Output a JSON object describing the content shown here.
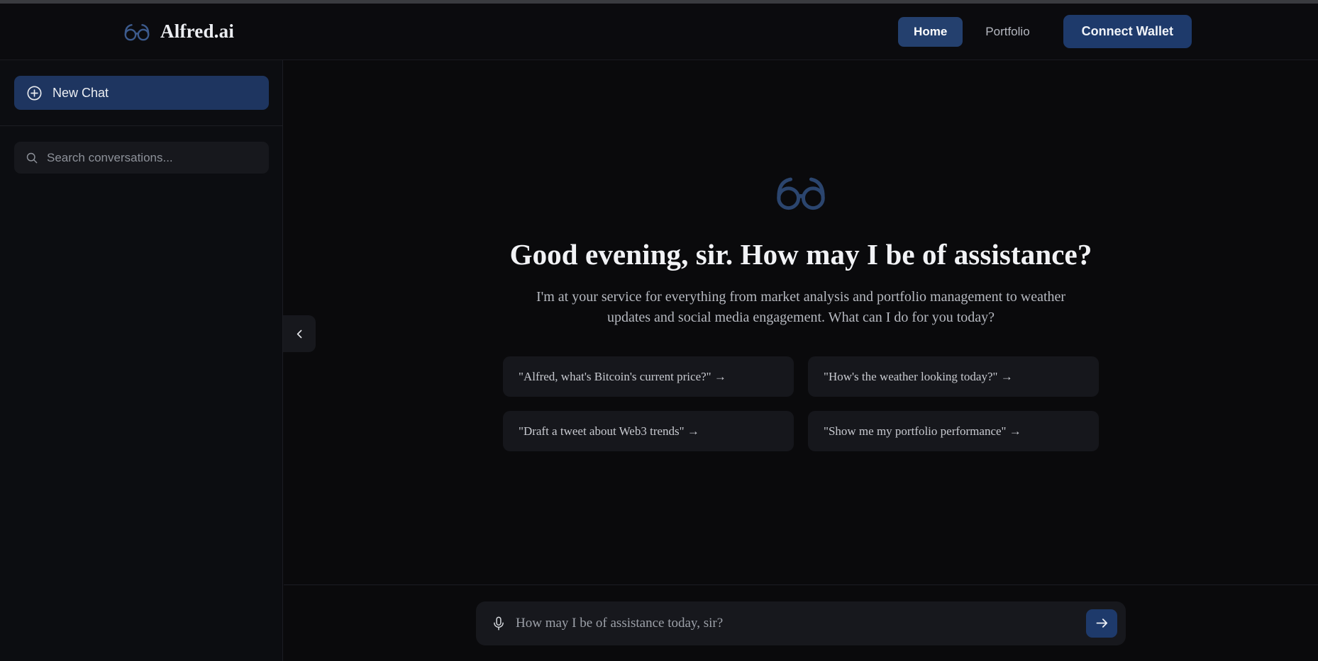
{
  "colors": {
    "page_bg": "#0a0a0c",
    "sidebar_bg": "#0c0d11",
    "header_bg": "#0b0b0e",
    "accent_blue": "#1e3a6b",
    "active_nav_blue": "#24406e",
    "new_chat_blue": "#1e3560",
    "card_bg": "#16171c",
    "logo_blue": "#3c5a8c",
    "hero_logo_blue": "#2b456e",
    "text_primary": "#f1f2f5",
    "text_secondary": "#b6b9c0",
    "border": "#1c1d23"
  },
  "header": {
    "brand_name": "Alfred.ai",
    "brand_logo_icon": "glasses-icon",
    "nav": [
      {
        "label": "Home",
        "active": true
      },
      {
        "label": "Portfolio",
        "active": false
      }
    ],
    "connect_wallet_label": "Connect Wallet"
  },
  "sidebar": {
    "new_chat_label": "New Chat",
    "new_chat_icon": "plus-circle-icon",
    "search_icon": "search-icon",
    "search_placeholder": "Search conversations...",
    "search_value": "",
    "collapse_toggle_icon": "chevron-left-icon"
  },
  "main": {
    "hero_logo_icon": "glasses-icon",
    "title": "Good evening, sir. How may I be of assistance?",
    "subtitle": "I'm at your service for everything from market analysis and portfolio management to weather updates and social media engagement. What can I do for you today?",
    "suggestions": [
      {
        "text": "\"Alfred, what's Bitcoin's current price?\"  →"
      },
      {
        "text": "\"How's the weather looking today?\"  →"
      },
      {
        "text": "\"Draft a tweet about Web3 trends\"  →"
      },
      {
        "text": "\"Show me my portfolio performance\"  →"
      }
    ]
  },
  "composer": {
    "mic_icon": "microphone-icon",
    "input_placeholder": "How may I be of assistance today, sir?",
    "input_value": "",
    "send_icon": "arrow-right-icon"
  }
}
